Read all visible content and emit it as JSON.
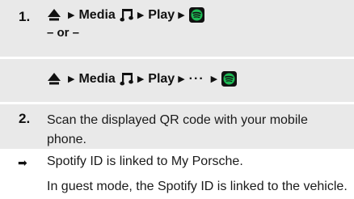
{
  "step1": {
    "number": "1.",
    "path_a": {
      "home_icon": "home-icon",
      "separator": "▶",
      "media_label": "Media",
      "music_icon": "music-note-icon",
      "play_label": "Play",
      "spotify_icon": "spotify-icon"
    },
    "or_text": "– or –",
    "path_b": {
      "home_icon": "home-icon",
      "separator": "▶",
      "media_label": "Media",
      "music_icon": "music-note-icon",
      "play_label": "Play",
      "more_label": "···",
      "spotify_icon": "spotify-icon"
    }
  },
  "step2": {
    "number": "2.",
    "text": "Scan the displayed QR code with your mobile phone."
  },
  "result": {
    "arrow": "➡",
    "text": "Spotify ID is linked to My Porsche.",
    "note": "In guest mode, the Spotify ID is linked to the vehicle."
  },
  "colors": {
    "step_background": "#e9e9e9",
    "spotify_green": "#1db954",
    "text": "#1a1a1a"
  }
}
